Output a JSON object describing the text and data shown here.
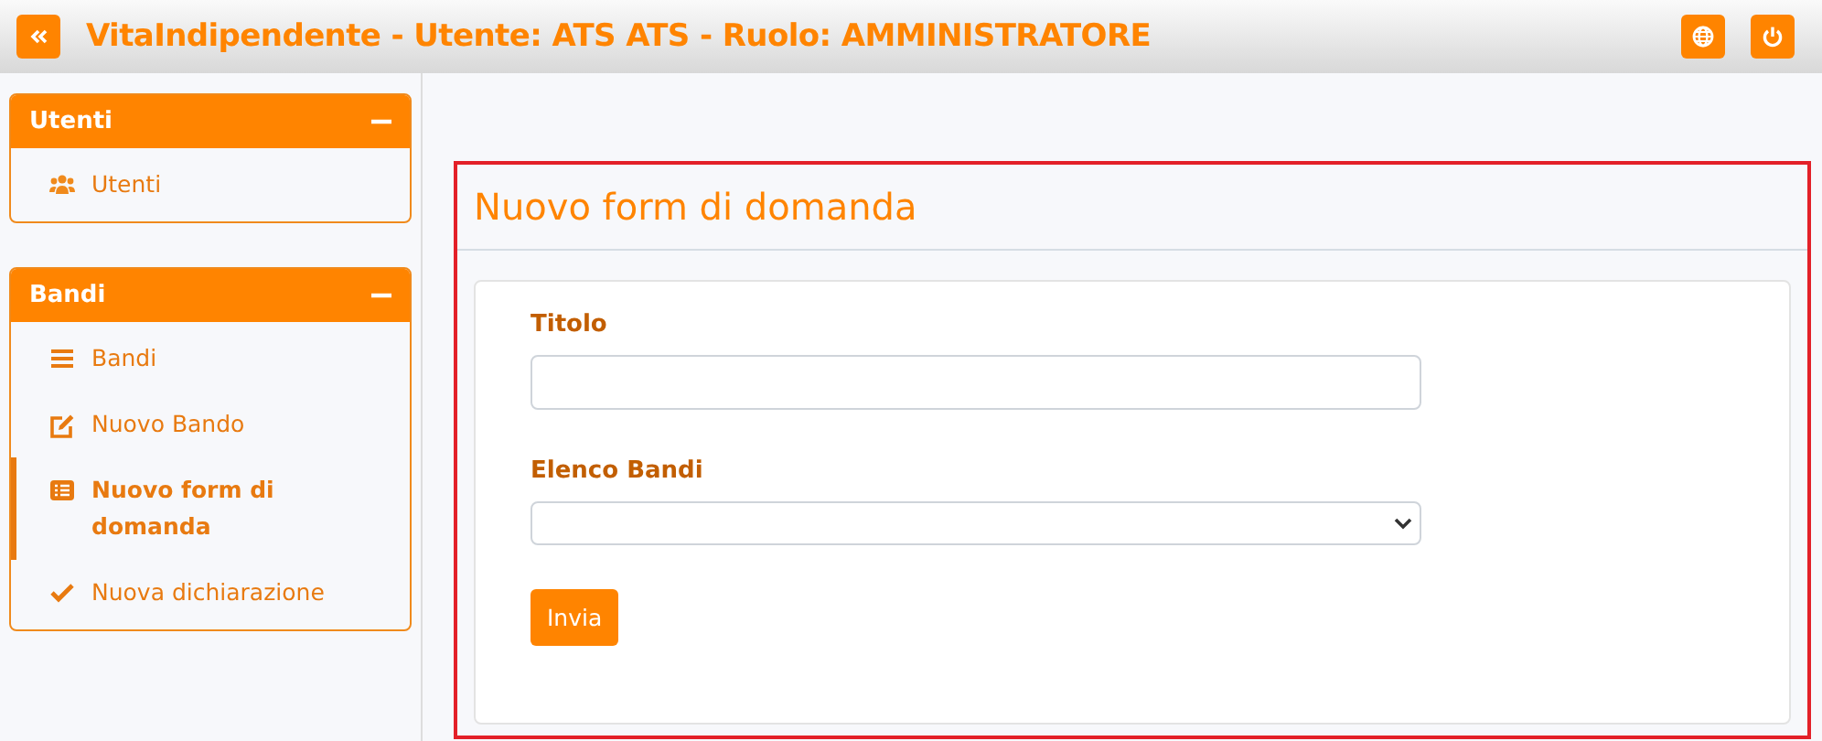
{
  "header": {
    "title": "VitaIndipendente - Utente: ATS ATS - Ruolo: AMMINISTRATORE"
  },
  "sidebar": {
    "panels": [
      {
        "title": "Utenti",
        "expanded": true,
        "items": [
          {
            "label": "Utenti",
            "selected": false
          }
        ]
      },
      {
        "title": "Bandi",
        "expanded": true,
        "items": [
          {
            "label": "Bandi",
            "selected": false
          },
          {
            "label": "Nuovo Bando",
            "selected": false
          },
          {
            "label": "Nuovo form di domanda",
            "selected": true
          },
          {
            "label": "Nuova dichiarazione",
            "selected": false
          }
        ]
      }
    ]
  },
  "main": {
    "title": "Nuovo form di domanda",
    "highlighted": true,
    "form": {
      "fields": [
        {
          "kind": "text",
          "label": "Titolo"
        },
        {
          "kind": "select",
          "label": "Elenco Bandi"
        }
      ],
      "submit": "Invia"
    }
  }
}
